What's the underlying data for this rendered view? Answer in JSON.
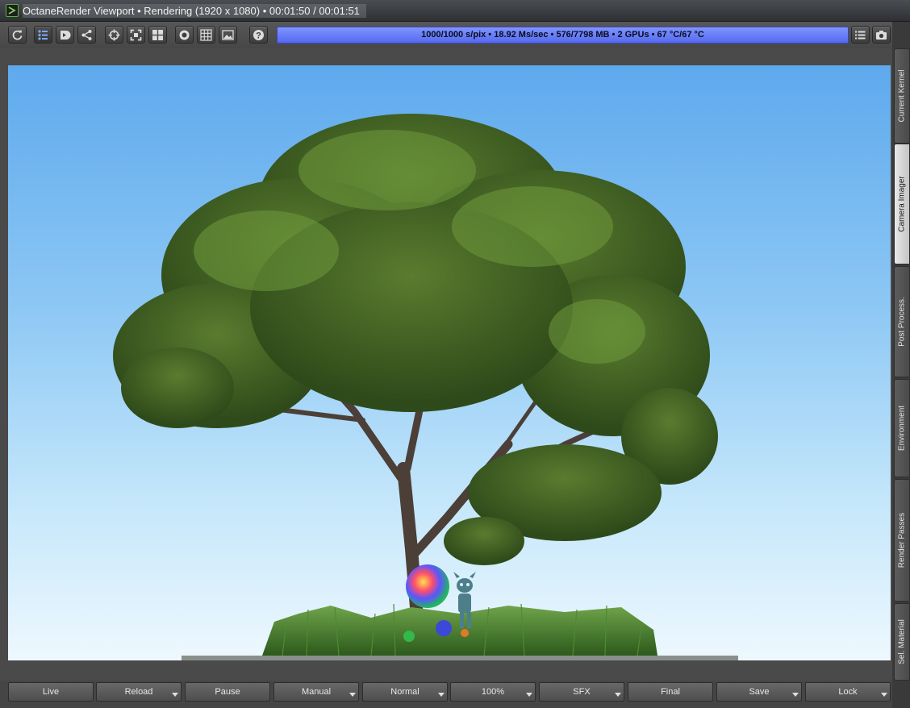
{
  "window": {
    "title": "OctaneRender Viewport • Rendering (1920 x 1080) • 00:01:50 / 00:01:51"
  },
  "toolbar": {
    "buttons": [
      {
        "icon": "refresh-icon"
      },
      {
        "icon": "render-settings-icon"
      },
      {
        "icon": "render-region-icon"
      },
      {
        "icon": "share-icon"
      },
      {
        "icon": "crosshair-focus-icon"
      },
      {
        "icon": "fit-frame-icon"
      },
      {
        "icon": "grid-layout-icon"
      },
      {
        "icon": "stop-icon"
      },
      {
        "icon": "table-grid-icon"
      },
      {
        "icon": "image-icon"
      },
      {
        "icon": "help-icon"
      }
    ],
    "status": "1000/1000 s/pix • 18.92 Ms/sec • 576/7798 MB • 2 GPUs • 67 °C/67 °C",
    "right_icons": [
      "list-icon",
      "camera-icon"
    ]
  },
  "side_tabs": [
    {
      "label": "Current Kernel",
      "active": false
    },
    {
      "label": "Camera Imager",
      "active": true
    },
    {
      "label": "Post Process.",
      "active": false
    },
    {
      "label": "Environment",
      "active": false
    },
    {
      "label": "Render Passes",
      "active": false
    },
    {
      "label": "Sel. Material",
      "active": false
    }
  ],
  "bottom_buttons": [
    {
      "label": "Live",
      "dropdown": false
    },
    {
      "label": "Reload",
      "dropdown": true
    },
    {
      "label": "Pause",
      "dropdown": false
    },
    {
      "label": "Manual",
      "dropdown": true
    },
    {
      "label": "Normal",
      "dropdown": true
    },
    {
      "label": "100%",
      "dropdown": true
    },
    {
      "label": "SFX",
      "dropdown": true
    },
    {
      "label": "Final",
      "dropdown": false
    },
    {
      "label": "Save",
      "dropdown": true
    },
    {
      "label": "Lock",
      "dropdown": true
    }
  ],
  "colors": {
    "status_bar": "#6a7ff8",
    "active_tab": "#d8d8d8",
    "sky_top": "#5ea9ed",
    "sky_bottom": "#eef8fe",
    "foliage": "#4b6a2a",
    "grass": "#3f7a2a"
  }
}
